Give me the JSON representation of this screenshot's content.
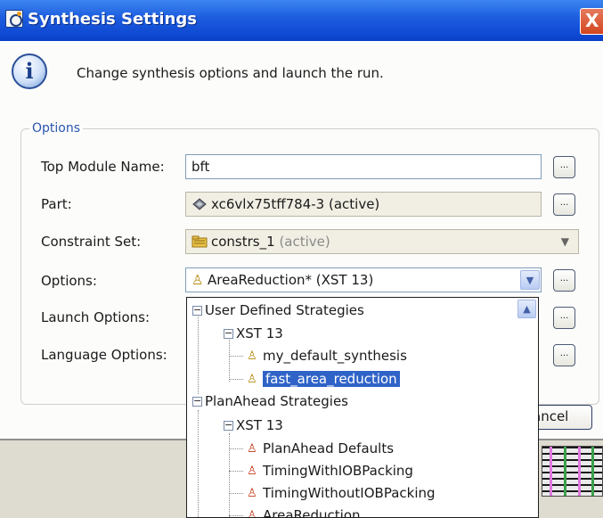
{
  "window": {
    "title": "Synthesis Settings",
    "close_label": "X"
  },
  "header": {
    "info_glyph": "i",
    "message": "Change synthesis options and launch the run."
  },
  "options_group": {
    "legend": "Options"
  },
  "fields": {
    "top_module": {
      "label": "Top Module Name:",
      "value": "bft"
    },
    "part": {
      "label": "Part:",
      "value": "xc6vlx75tff784-3 (active)"
    },
    "constraint_set": {
      "label": "Constraint Set:",
      "value": "constrs_1",
      "note": "(active)"
    },
    "options": {
      "label": "Options:",
      "value": "AreaReduction* (XST 13)"
    },
    "launch_options": {
      "label": "Launch Options:"
    },
    "language_options": {
      "label": "Language Options:"
    }
  },
  "buttons": {
    "browse_label": "...",
    "cancel_label": "ancel"
  },
  "dropdown_tree": {
    "user_defined": {
      "label": "User Defined Strategies",
      "group": "XST 13",
      "items": [
        "my_default_synthesis",
        "fast_area_reduction"
      ]
    },
    "planahead": {
      "label": "PlanAhead Strategies",
      "group": "XST 13",
      "items": [
        "PlanAhead Defaults",
        "TimingWithIOBPacking",
        "TimingWithoutIOBPacking",
        "AreaReduction"
      ]
    },
    "selected": "fast_area_reduction"
  },
  "icons": {
    "info": "info-icon",
    "part": "chip-icon",
    "constraint": "folder-icon",
    "strategy": "person-icon",
    "predefined_strategy": "person-red-icon"
  },
  "colors": {
    "titlebar": "#0e48d2",
    "selection": "#2f63c8",
    "legend": "#2a55b0"
  }
}
